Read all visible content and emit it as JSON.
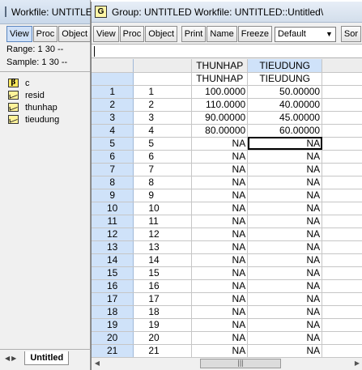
{
  "workfile": {
    "title": "Workfile: UNTITLED",
    "toolbar": [
      "View",
      "Proc",
      "Object"
    ],
    "range_label": "Range:",
    "range_value": "1 30  --",
    "sample_label": "Sample:",
    "sample_value": "1 30  --",
    "objects": [
      {
        "name": "c",
        "icon": "coef-vector-icon"
      },
      {
        "name": "resid",
        "icon": "series-icon"
      },
      {
        "name": "thunhap",
        "icon": "series-icon"
      },
      {
        "name": "tieudung",
        "icon": "series-icon"
      }
    ],
    "tab": "Untitled"
  },
  "group": {
    "icon_letter": "G",
    "title": "Group: UNTITLED   Workfile: UNTITLED::Untitled\\",
    "toolbar": [
      "View",
      "Proc",
      "Object",
      "Print",
      "Name",
      "Freeze"
    ],
    "select_value": "Default",
    "cut_button": "Sor",
    "columns": [
      "THUNHAP",
      "TIEUDUNG"
    ],
    "column_subheaders": [
      "THUNHAP",
      "TIEUDUNG"
    ],
    "rows": [
      {
        "row": "1",
        "obs": "1",
        "thunhap": "100.0000",
        "tieudung": "50.00000"
      },
      {
        "row": "2",
        "obs": "2",
        "thunhap": "110.0000",
        "tieudung": "40.00000"
      },
      {
        "row": "3",
        "obs": "3",
        "thunhap": "90.00000",
        "tieudung": "45.00000"
      },
      {
        "row": "4",
        "obs": "4",
        "thunhap": "80.00000",
        "tieudung": "60.00000"
      },
      {
        "row": "5",
        "obs": "5",
        "thunhap": "NA",
        "tieudung": "NA"
      },
      {
        "row": "6",
        "obs": "6",
        "thunhap": "NA",
        "tieudung": "NA"
      },
      {
        "row": "7",
        "obs": "7",
        "thunhap": "NA",
        "tieudung": "NA"
      },
      {
        "row": "8",
        "obs": "8",
        "thunhap": "NA",
        "tieudung": "NA"
      },
      {
        "row": "9",
        "obs": "9",
        "thunhap": "NA",
        "tieudung": "NA"
      },
      {
        "row": "10",
        "obs": "10",
        "thunhap": "NA",
        "tieudung": "NA"
      },
      {
        "row": "11",
        "obs": "11",
        "thunhap": "NA",
        "tieudung": "NA"
      },
      {
        "row": "12",
        "obs": "12",
        "thunhap": "NA",
        "tieudung": "NA"
      },
      {
        "row": "13",
        "obs": "13",
        "thunhap": "NA",
        "tieudung": "NA"
      },
      {
        "row": "14",
        "obs": "14",
        "thunhap": "NA",
        "tieudung": "NA"
      },
      {
        "row": "15",
        "obs": "15",
        "thunhap": "NA",
        "tieudung": "NA"
      },
      {
        "row": "16",
        "obs": "16",
        "thunhap": "NA",
        "tieudung": "NA"
      },
      {
        "row": "17",
        "obs": "17",
        "thunhap": "NA",
        "tieudung": "NA"
      },
      {
        "row": "18",
        "obs": "18",
        "thunhap": "NA",
        "tieudung": "NA"
      },
      {
        "row": "19",
        "obs": "19",
        "thunhap": "NA",
        "tieudung": "NA"
      },
      {
        "row": "20",
        "obs": "20",
        "thunhap": "NA",
        "tieudung": "NA"
      },
      {
        "row": "21",
        "obs": "21",
        "thunhap": "NA",
        "tieudung": "NA"
      }
    ],
    "selected_row": "5"
  },
  "colors": {
    "row_header": "#cfe2f9",
    "title_bar": "#d3deeb"
  }
}
